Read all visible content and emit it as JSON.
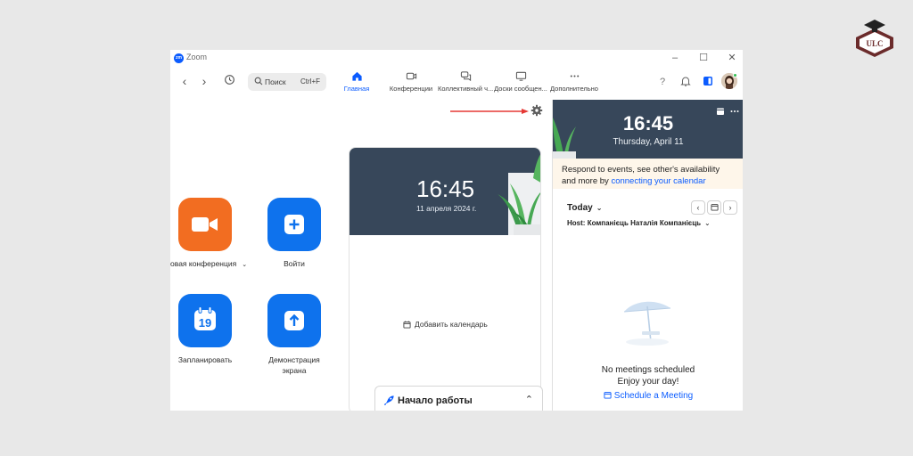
{
  "window": {
    "title": "Zoom",
    "app_icon": "zm"
  },
  "toolbar": {
    "search_placeholder": "Поиск",
    "search_shortcut": "Ctrl+F",
    "tabs": [
      {
        "label": "Главная",
        "icon": "home-icon",
        "active": true
      },
      {
        "label": "Конференции",
        "icon": "video-icon",
        "active": false
      },
      {
        "label": "Коллективный ч...",
        "icon": "chat-icon",
        "active": false
      },
      {
        "label": "Доски сообщен...",
        "icon": "whiteboard-icon",
        "active": false
      },
      {
        "label": "Дополнительно",
        "icon": "more-icon",
        "active": false
      }
    ]
  },
  "actions": {
    "new_meeting": "Новая конференция",
    "join": "Войти",
    "schedule": "Запланировать",
    "schedule_day": "19",
    "share_line1": "Демонстрация",
    "share_line2": "экрана"
  },
  "card": {
    "time": "16:45",
    "date": "11 апреля 2024 г.",
    "add_calendar": "Добавить календарь",
    "get_started": "Начало работы"
  },
  "right_panel": {
    "time": "16:45",
    "date": "Thursday, April 11",
    "banner_text": "Respond to events, see other's availability and more by",
    "banner_link": "connecting your calendar",
    "today": "Today",
    "host_label": "Host:",
    "host_name": "Компанієць Наталія Компанієць",
    "empty_title": "No meetings scheduled",
    "empty_sub": "Enjoy your day!",
    "schedule_link": "Schedule a Meeting"
  },
  "logo": {
    "text": "ULC"
  },
  "colors": {
    "accent": "#0b5cff",
    "orange": "#f26d21",
    "action_blue": "#0e72ed",
    "header_dark": "#37475a",
    "annotation_arrow": "#e53935"
  }
}
